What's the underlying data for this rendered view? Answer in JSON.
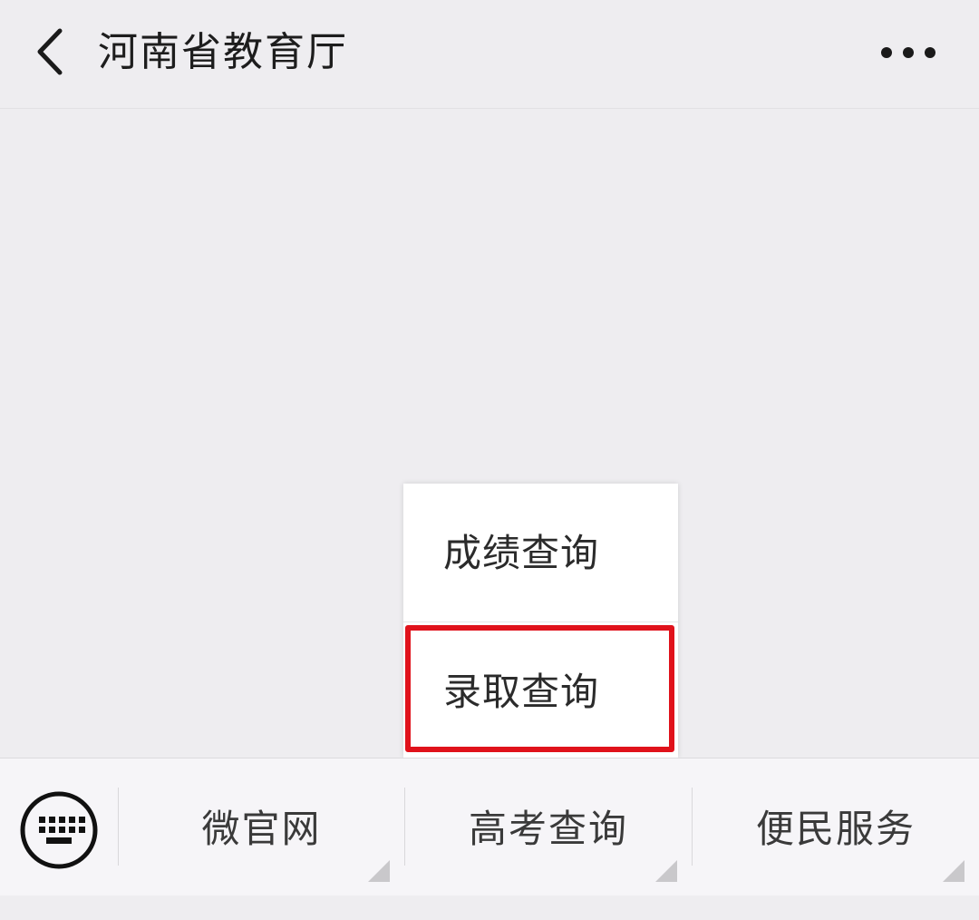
{
  "header": {
    "back_icon": "chevron-left-icon",
    "title": "河南省教育厅",
    "more_icon": "more-dots-icon"
  },
  "submenu": {
    "items": [
      {
        "label": "成绩查询"
      },
      {
        "label": "录取查询",
        "highlighted": true
      }
    ],
    "highlight_color": "#e0121b"
  },
  "menu_bar": {
    "keyboard_icon": "keyboard-icon",
    "buttons": [
      {
        "label": "微官网"
      },
      {
        "label": "高考查询"
      },
      {
        "label": "便民服务"
      }
    ]
  }
}
